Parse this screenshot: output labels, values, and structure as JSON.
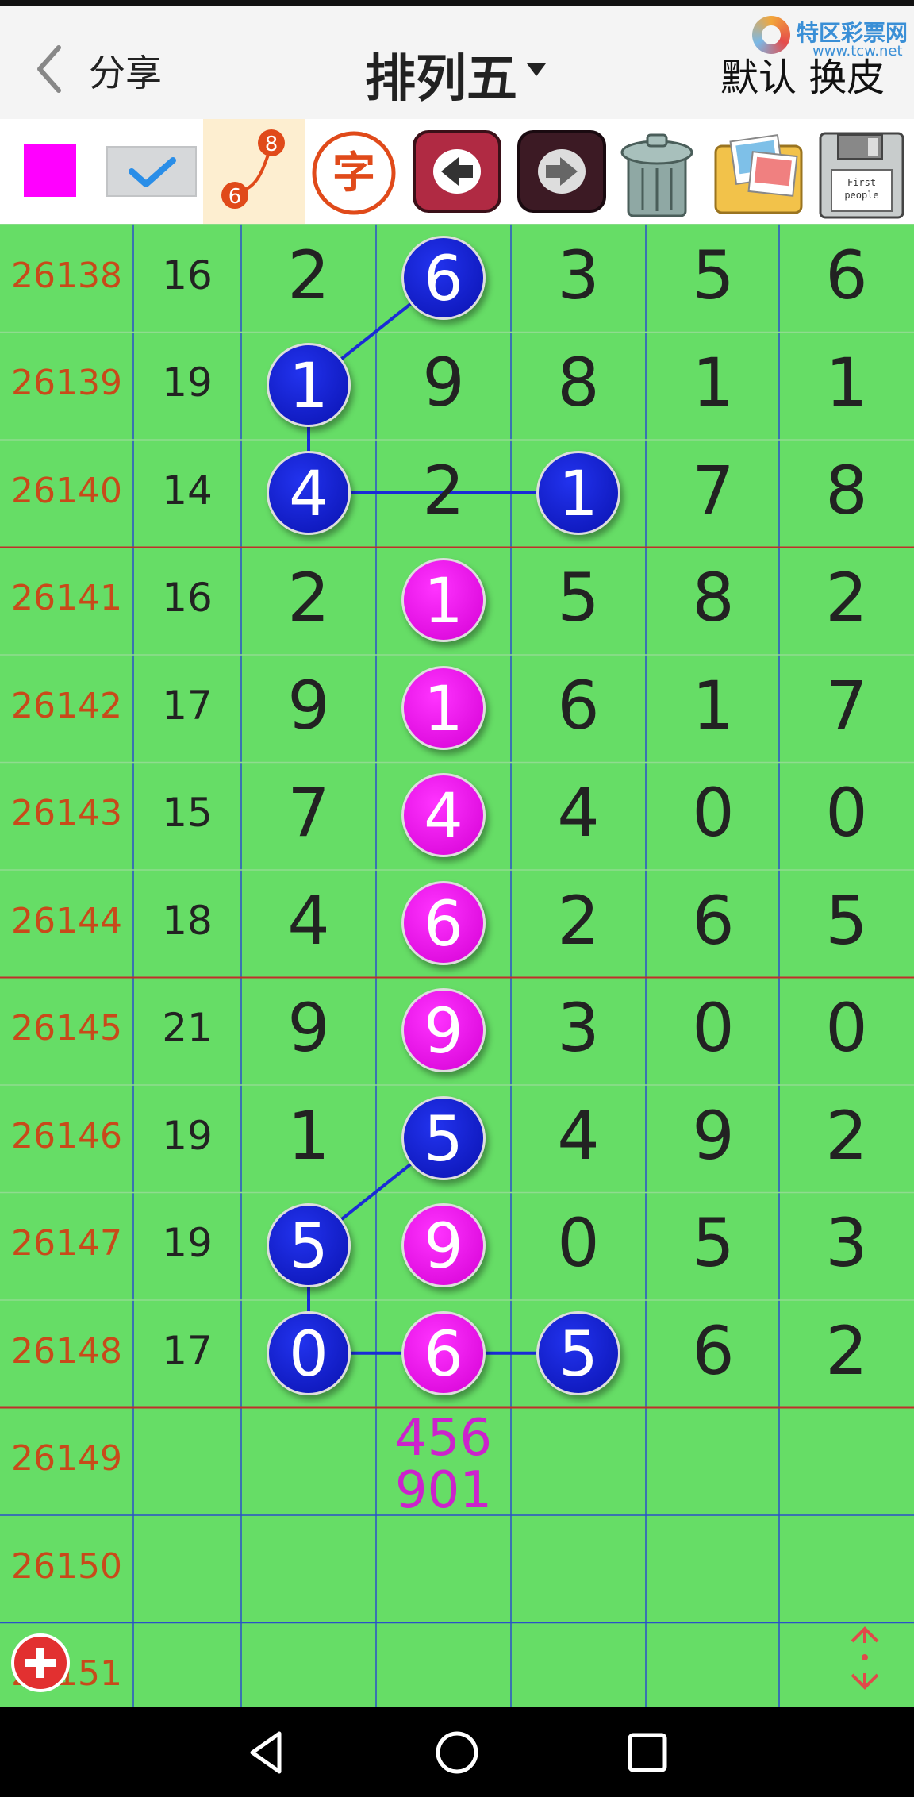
{
  "header": {
    "back_icon": "chevron-left-icon",
    "share_label": "分享",
    "title": "排列五",
    "default_skin_label": "默认 换皮",
    "watermark_text": "特区彩票网",
    "watermark_url": "www.tcw.net"
  },
  "toolbar": {
    "swatch_color": "#ff00ff",
    "path_icon_numbers": [
      "8",
      "6"
    ],
    "zi_label": "字",
    "floppy_text": [
      "First",
      "people"
    ]
  },
  "rows": [
    {
      "id": "26138",
      "sum": "16",
      "digits": [
        "2",
        "6",
        "3",
        "5",
        "6"
      ]
    },
    {
      "id": "26139",
      "sum": "19",
      "digits": [
        "1",
        "9",
        "8",
        "1",
        "1"
      ]
    },
    {
      "id": "26140",
      "sum": "14",
      "digits": [
        "4",
        "2",
        "1",
        "7",
        "8"
      ]
    },
    {
      "id": "26141",
      "sum": "16",
      "digits": [
        "2",
        "1",
        "5",
        "8",
        "2"
      ]
    },
    {
      "id": "26142",
      "sum": "17",
      "digits": [
        "9",
        "1",
        "6",
        "1",
        "7"
      ]
    },
    {
      "id": "26143",
      "sum": "15",
      "digits": [
        "7",
        "4",
        "4",
        "0",
        "0"
      ]
    },
    {
      "id": "26144",
      "sum": "18",
      "digits": [
        "4",
        "6",
        "2",
        "6",
        "5"
      ]
    },
    {
      "id": "26145",
      "sum": "21",
      "digits": [
        "9",
        "9",
        "3",
        "0",
        "0"
      ]
    },
    {
      "id": "26146",
      "sum": "19",
      "digits": [
        "1",
        "5",
        "4",
        "9",
        "2"
      ]
    },
    {
      "id": "26147",
      "sum": "19",
      "digits": [
        "5",
        "9",
        "0",
        "5",
        "3"
      ]
    },
    {
      "id": "26148",
      "sum": "17",
      "digits": [
        "0",
        "6",
        "5",
        "6",
        "2"
      ]
    },
    {
      "id": "26149",
      "sum": "",
      "digits": [
        "",
        "",
        "",
        "",
        ""
      ]
    },
    {
      "id": "26150",
      "sum": "",
      "digits": [
        "",
        "",
        "",
        "",
        ""
      ]
    },
    {
      "id": "26151",
      "sum": "",
      "digits": [
        "",
        "",
        "",
        "",
        ""
      ]
    }
  ],
  "highlights": [
    {
      "row": 0,
      "col": 1,
      "color": "blue"
    },
    {
      "row": 1,
      "col": 0,
      "color": "blue"
    },
    {
      "row": 2,
      "col": 0,
      "color": "blue"
    },
    {
      "row": 2,
      "col": 2,
      "color": "blue"
    },
    {
      "row": 3,
      "col": 1,
      "color": "magenta"
    },
    {
      "row": 4,
      "col": 1,
      "color": "magenta"
    },
    {
      "row": 5,
      "col": 1,
      "color": "magenta"
    },
    {
      "row": 6,
      "col": 1,
      "color": "magenta"
    },
    {
      "row": 7,
      "col": 1,
      "color": "magenta"
    },
    {
      "row": 8,
      "col": 1,
      "color": "blue"
    },
    {
      "row": 9,
      "col": 0,
      "color": "blue"
    },
    {
      "row": 9,
      "col": 1,
      "color": "magenta"
    },
    {
      "row": 10,
      "col": 0,
      "color": "blue"
    },
    {
      "row": 10,
      "col": 1,
      "color": "magenta"
    },
    {
      "row": 10,
      "col": 2,
      "color": "blue"
    }
  ],
  "prediction": {
    "row": 11,
    "col": 1,
    "lines": [
      "456",
      "901"
    ]
  },
  "colors": {
    "grid_bg": "#66dd66",
    "row_id": "#c84a1a",
    "blue_ball": "#0a12b0",
    "magenta_ball": "#d400d4",
    "prediction": "#cc22cc",
    "connector": "#1a2bd6"
  },
  "controls": {
    "add_icon": "plus-circle-icon",
    "scroll_icon": "up-down-arrows-icon"
  },
  "navbar": {
    "back_icon": "triangle-back-icon",
    "home_icon": "circle-home-icon",
    "recents_icon": "square-recents-icon"
  }
}
